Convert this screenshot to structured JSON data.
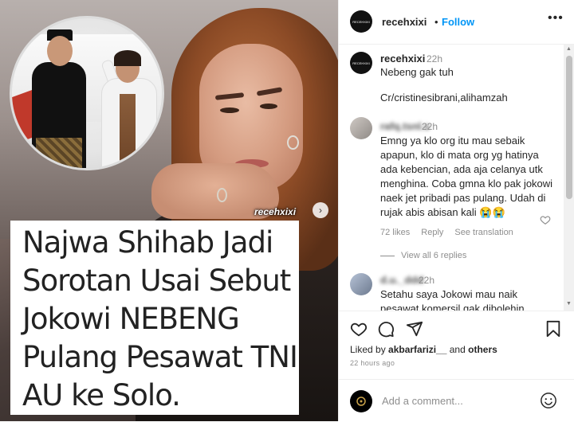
{
  "post": {
    "watermark": "recehxixi",
    "headline": "Najwa Shihab Jadi Sorotan Usai Sebut Jokowi NEBENG Pulang Pesawat TNI AU ke Solo."
  },
  "header": {
    "username": "recehxixi",
    "separator": "•",
    "follow_label": "Follow",
    "more_icon": "more-horizontal-icon",
    "avatar_text": "RECEHXIXI"
  },
  "caption": {
    "username": "recehxixi",
    "time": "22h",
    "line1": "Nebeng gak tuh",
    "line2": "Cr/cristinesibrani,alihamzah"
  },
  "comments": [
    {
      "username": "rafq.tsnl.s",
      "time": "22h",
      "text": "Emng ya klo org itu mau sebaik apapun, klo di mata org yg hatinya ada kebencian, ada aja celanya utk menghina. Coba gmna klo pak jokowi naek jet pribadi pas pulang. Udah di rujak abis abisan kali 😭😭",
      "likes": "72 likes",
      "reply": "Reply",
      "translate": "See translation",
      "view_replies": "View all 6 replies"
    },
    {
      "username": "d.u._ddd",
      "time": "22h",
      "text": "Setahu saya Jokowi mau naik pesawat komersil gak dibolehin"
    }
  ],
  "actions": {
    "liked_by_prefix": "Liked by ",
    "liked_by_user": "akbarfarizi__",
    "liked_by_suffix": " and ",
    "liked_by_others": "others",
    "time_ago": "22 hours ago"
  },
  "add_comment": {
    "placeholder": "Add a comment..."
  },
  "colors": {
    "accent": "#0095f6",
    "muted": "#8e8e8e",
    "text": "#262626"
  }
}
